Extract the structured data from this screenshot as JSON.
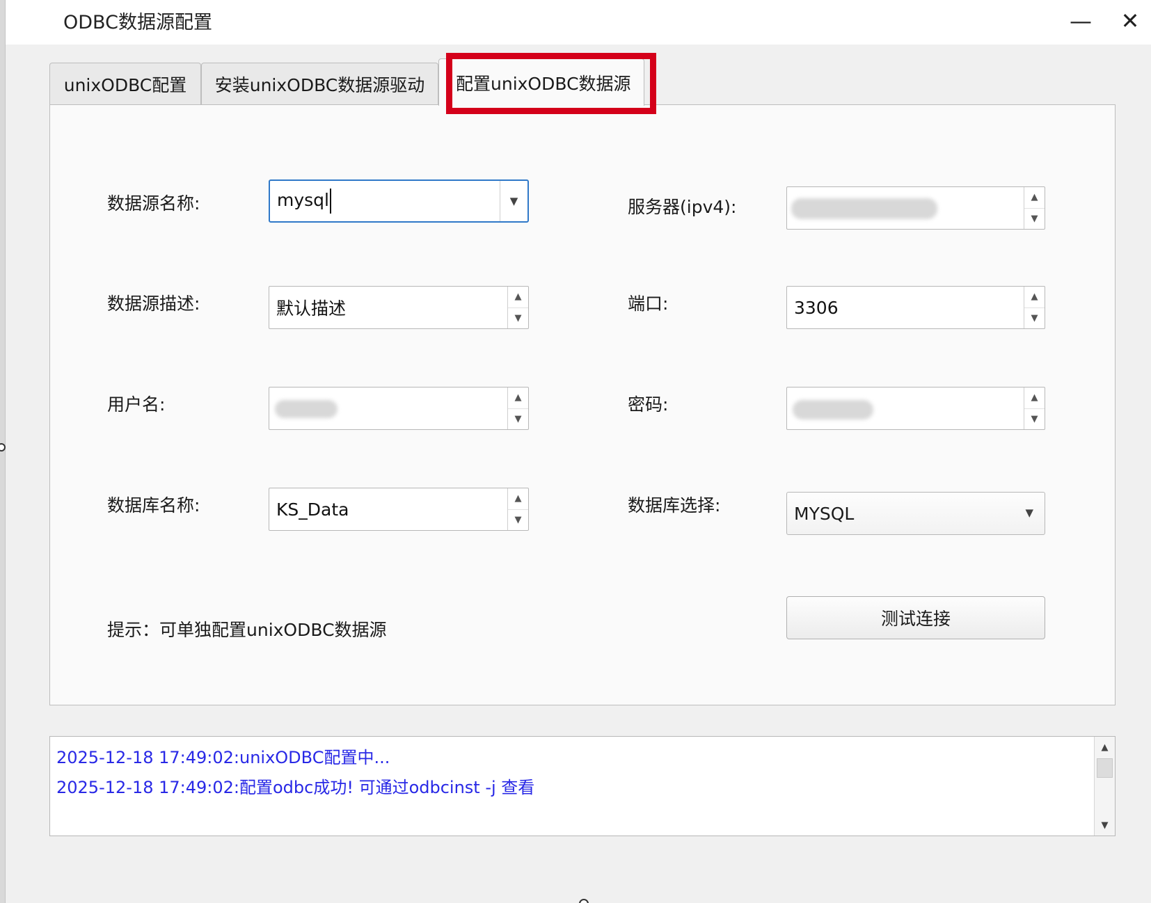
{
  "window": {
    "title": "ODBC数据源配置",
    "minimize_glyph": "—",
    "close_glyph": "✕"
  },
  "tabs": [
    {
      "label": "unixODBC配置",
      "active": false
    },
    {
      "label": "安装unixODBC数据源驱动",
      "active": false
    },
    {
      "label": "配置unixODBC数据源",
      "active": true
    }
  ],
  "form": {
    "dsn_name": {
      "label": "数据源名称:",
      "value": "mysql"
    },
    "dsn_desc": {
      "label": "数据源描述:",
      "value": "默认描述"
    },
    "username": {
      "label": "用户名:",
      "value": ""
    },
    "db_name": {
      "label": "数据库名称:",
      "value": "KS_Data"
    },
    "server": {
      "label": "服务器(ipv4):",
      "value": ""
    },
    "port": {
      "label": "端口:",
      "value": "3306"
    },
    "password": {
      "label": "密码:",
      "value": ""
    },
    "db_select": {
      "label": "数据库选择:",
      "value": "MYSQL"
    },
    "hint": "提示：可单独配置unixODBC数据源",
    "test_button": "测试连接"
  },
  "log": {
    "lines": [
      "2025-12-18 17:49:02:unixODBC配置中...",
      "2025-12-18 17:49:02:配置odbc成功! 可通过odbcinst -j 查看"
    ],
    "text_color": "#2828e6"
  },
  "colors": {
    "highlight_border": "#d4001a",
    "focus_border": "#2f78c8"
  },
  "icons": {
    "dropdown": "▼",
    "spin_up": "▲",
    "spin_down": "▼"
  }
}
